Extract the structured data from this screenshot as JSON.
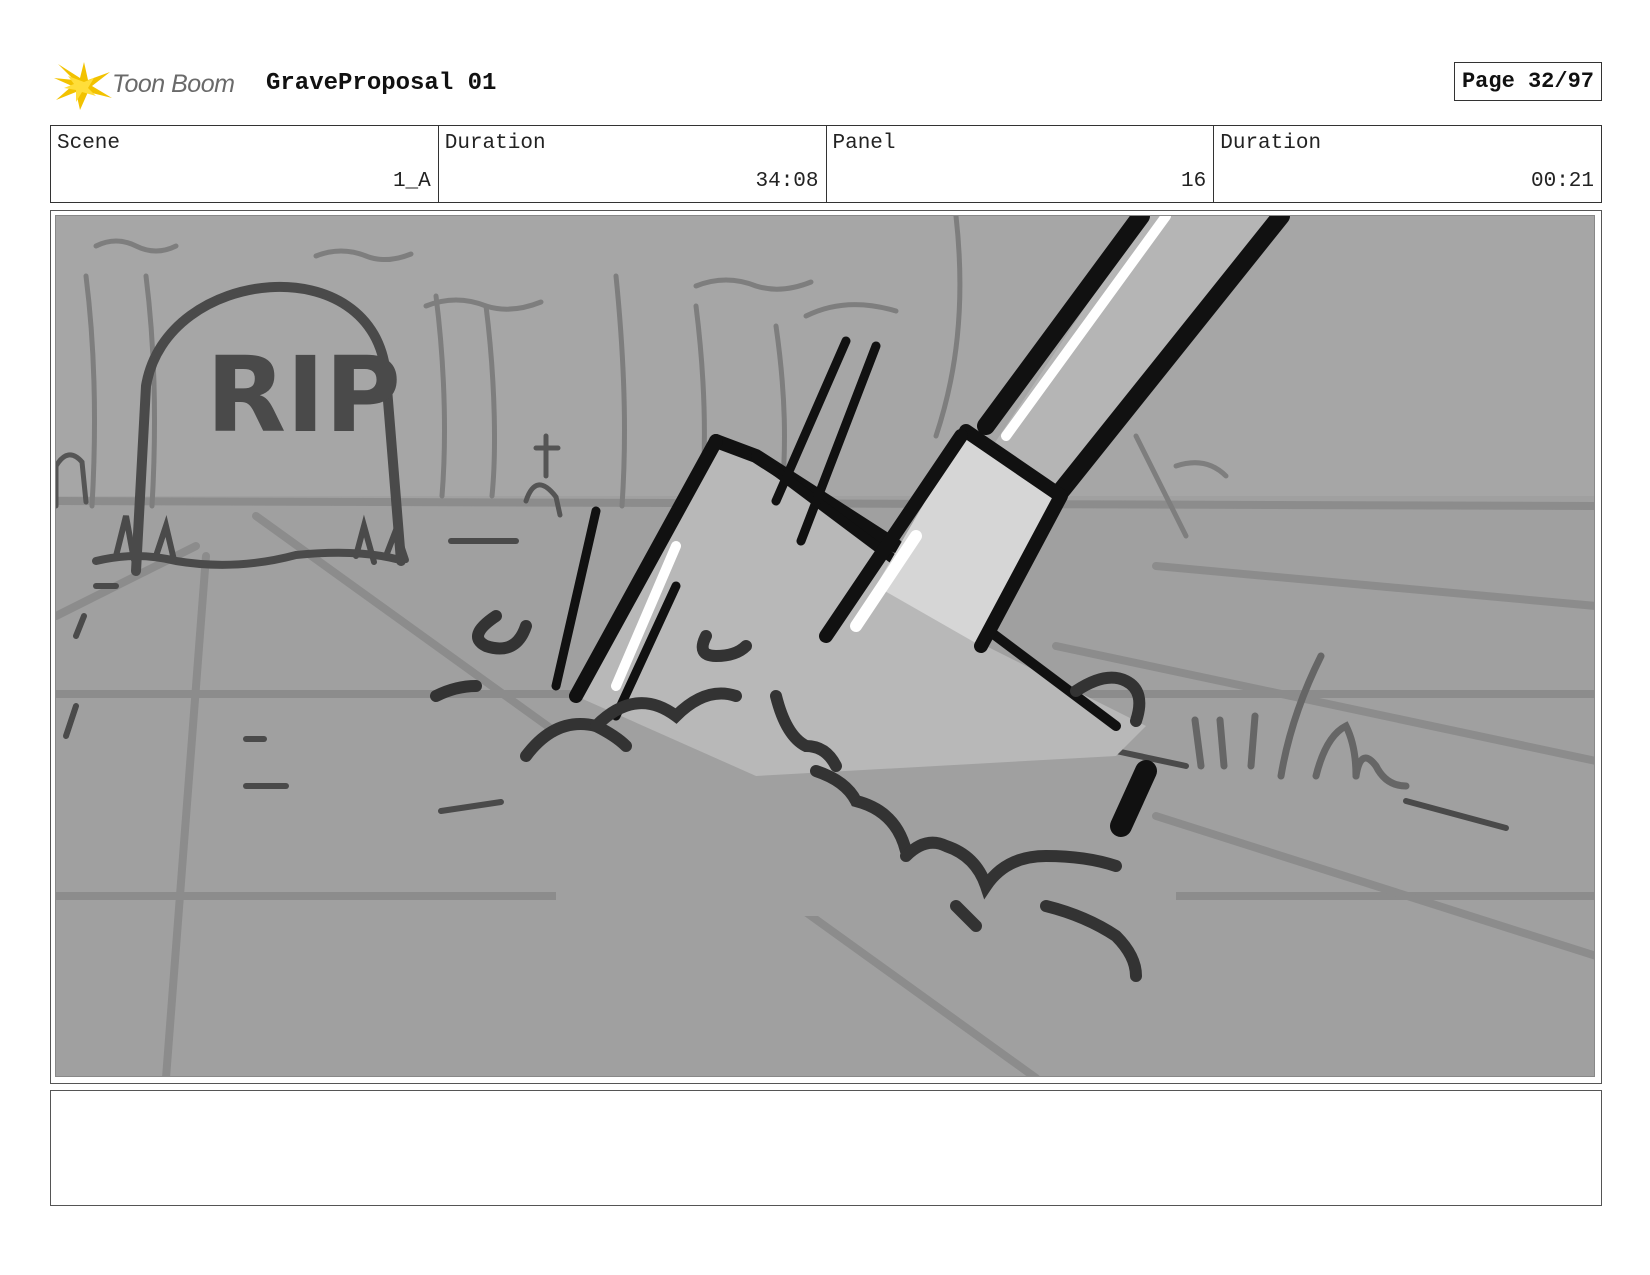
{
  "header": {
    "logo_text": "Toon Boom",
    "project_title": "GraveProposal 01",
    "page_label": "Page 32/97"
  },
  "info": {
    "scene_label": "Scene",
    "scene_value": "1_A",
    "scene_duration_label": "Duration",
    "scene_duration_value": "34:08",
    "panel_label": "Panel",
    "panel_value": "16",
    "panel_duration_label": "Duration",
    "panel_duration_value": "00:21"
  },
  "panel": {
    "tombstone_text": "RIP"
  },
  "caption": {
    "text": ""
  },
  "colors": {
    "logo_star": "#f2c200",
    "sky": "#a4a4a4",
    "ground": "#a0a0a0",
    "line_dark": "#333333",
    "shovel_fill": "#b8b8b8"
  }
}
